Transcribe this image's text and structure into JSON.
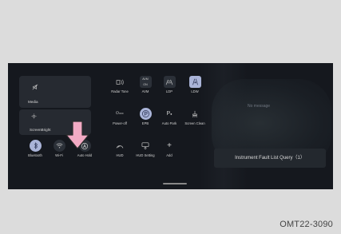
{
  "left_panel": {
    "media": {
      "icon": "mute-icon",
      "label": "Media"
    },
    "screen_bright": {
      "icon": "brightness-icon",
      "label": "ScreenBright"
    },
    "quick_buttons": [
      {
        "icon": "bluetooth-icon",
        "label": "Bluetooth",
        "active": true
      },
      {
        "icon": "wifi-icon",
        "label": "Wi-Fi",
        "active": false
      },
      {
        "icon": "auto-hold-icon",
        "label": "Auto Hold",
        "active": false
      }
    ]
  },
  "grid": {
    "row1": [
      {
        "icon": "radar-tone-icon",
        "label": "Radar Tone",
        "active": false
      },
      {
        "icon": "avm-icon",
        "label": "AVM",
        "active": false
      },
      {
        "icon": "ldp-icon",
        "label": "LDP",
        "active": false
      },
      {
        "icon": "ldw-icon",
        "label": "LDW",
        "active": true
      }
    ],
    "row2": [
      {
        "icon": "power-off-icon",
        "label": "Power-off",
        "active": false
      },
      {
        "icon": "epb-icon",
        "label": "EPB",
        "active": true
      },
      {
        "icon": "auto-park-icon",
        "label": "Auto Park",
        "active": false
      },
      {
        "icon": "screen-clean-icon",
        "label": "Screen Clean",
        "active": false
      }
    ],
    "row3": [
      {
        "icon": "hud-icon",
        "label": "HUD",
        "active": false
      },
      {
        "icon": "hud-setting-icon",
        "label": "HUD Setting",
        "active": false
      },
      {
        "icon": "add-icon",
        "label": "Add",
        "active": false
      }
    ]
  },
  "right_panel": {
    "no_message": "No message",
    "fault_button": "Instrument Fault List Query（1）"
  },
  "caption": "OMT22-3090",
  "colors": {
    "screen_bg": "#15181e",
    "active": "#aab4d8",
    "arrow_pink": "#f2aac4"
  }
}
